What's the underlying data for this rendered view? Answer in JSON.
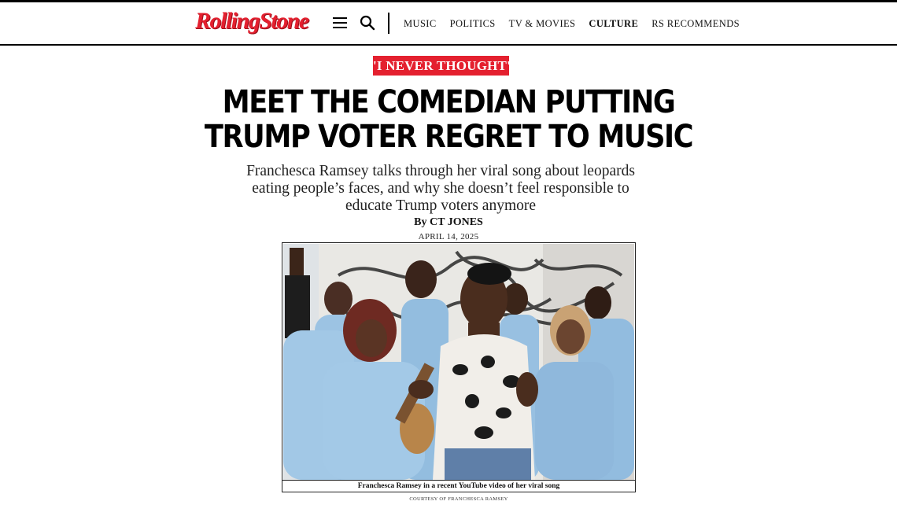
{
  "header": {
    "logo_text": "RollingStone",
    "nav": [
      {
        "label": "MUSIC",
        "active": false
      },
      {
        "label": "POLITICS",
        "active": false
      },
      {
        "label": "TV & MOVIES",
        "active": false
      },
      {
        "label": "CULTURE",
        "active": true
      },
      {
        "label": "RS RECOMMENDS",
        "active": false
      }
    ],
    "icons": [
      "menu-icon",
      "search-icon"
    ]
  },
  "article": {
    "kicker": "'I NEVER THOUGHT'",
    "headline": "MEET THE COMEDIAN PUTTING TRUMP VOTER REGRET TO MUSIC",
    "dek": "Franchesca Ramsey talks through her viral song about leopards eating people’s faces, and why she doesn’t feel responsible to educate Trump voters anymore",
    "byline": "By CT JONES",
    "date": "APRIL 14, 2025",
    "image": {
      "caption": "Franchesca Ramsey in a recent YouTube video of her viral song",
      "credit": "COURTESY OF FRANCHESCA RAMSEY"
    }
  },
  "colors": {
    "brand_red": "#e4202f",
    "robe_blue": "#8fb8dc",
    "text": "#111111"
  }
}
